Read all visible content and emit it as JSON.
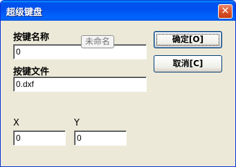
{
  "window": {
    "title": "超级键盘",
    "close_icon": "close-icon",
    "close_glyph": "✕"
  },
  "form": {
    "key_name_label": "按键名称",
    "key_name_value": "0",
    "key_name_tooltip": "未命名",
    "key_file_label": "按键文件",
    "key_file_value": "0.dxf",
    "x_label": "X",
    "x_value": "0",
    "y_label": "Y",
    "y_value": "0"
  },
  "buttons": {
    "ok_label": "确定[O]",
    "cancel_label": "取消[C]"
  },
  "colors": {
    "titlebar": "#0054e3",
    "dialog_face": "#ece9d8",
    "close_button": "#d9552f"
  }
}
